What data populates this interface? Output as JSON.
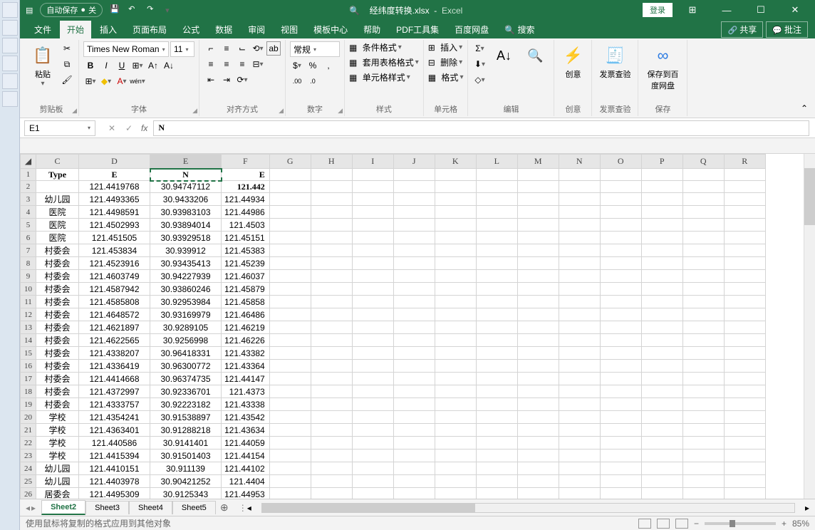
{
  "titlebar": {
    "autosave": "自动保存",
    "autosave_state": "关",
    "filename": "经纬度转换.xlsx",
    "app": "Excel",
    "login": "登录"
  },
  "tabs": {
    "file": "文件",
    "home": "开始",
    "insert": "插入",
    "pagelayout": "页面布局",
    "formulas": "公式",
    "data": "数据",
    "review": "审阅",
    "view": "视图",
    "template": "模板中心",
    "help": "帮助",
    "pdf": "PDF工具集",
    "baidu": "百度网盘",
    "search": "搜索",
    "share": "共享",
    "comment": "批注"
  },
  "ribbon": {
    "clipboard": {
      "paste": "粘贴",
      "label": "剪贴板"
    },
    "font": {
      "family": "Times New Roman",
      "size": "11",
      "label": "字体"
    },
    "align": {
      "label": "对齐方式"
    },
    "number": {
      "format": "常规",
      "label": "数字"
    },
    "styles": {
      "cond": "条件格式",
      "table": "套用表格格式",
      "cell": "单元格样式",
      "label": "样式"
    },
    "cells": {
      "insert": "插入",
      "delete": "删除",
      "format": "格式",
      "label": "单元格"
    },
    "editing": {
      "label": "编辑"
    },
    "creative": {
      "btn": "创意",
      "label": "创意"
    },
    "invoice": {
      "btn": "发票查验",
      "label": "发票查验"
    },
    "save": {
      "btn": "保存到百度网盘",
      "label": "保存"
    }
  },
  "namebox": {
    "ref": "E1",
    "formula": "N"
  },
  "columns": [
    "C",
    "D",
    "E",
    "F",
    "G",
    "H",
    "I",
    "J",
    "K",
    "L",
    "M",
    "N",
    "O",
    "P",
    "Q",
    "R"
  ],
  "headers": {
    "c": "Type",
    "d": "E",
    "e": "N",
    "f": "E"
  },
  "chart_data": {
    "type": "table",
    "columns": [
      "row",
      "Type",
      "E",
      "N",
      "F"
    ],
    "rows": [
      [
        2,
        "",
        "121.4419768",
        "30.94747112",
        "121.442"
      ],
      [
        3,
        "幼儿园",
        "121.4493365",
        "30.9433206",
        "121.44934"
      ],
      [
        4,
        "医院",
        "121.4498591",
        "30.93983103",
        "121.44986"
      ],
      [
        5,
        "医院",
        "121.4502993",
        "30.93894014",
        "121.4503"
      ],
      [
        6,
        "医院",
        "121.451505",
        "30.93929518",
        "121.45151"
      ],
      [
        7,
        "村委会",
        "121.453834",
        "30.939912",
        "121.45383"
      ],
      [
        8,
        "村委会",
        "121.4523916",
        "30.93435413",
        "121.45239"
      ],
      [
        9,
        "村委会",
        "121.4603749",
        "30.94227939",
        "121.46037"
      ],
      [
        10,
        "村委会",
        "121.4587942",
        "30.93860246",
        "121.45879"
      ],
      [
        11,
        "村委会",
        "121.4585808",
        "30.92953984",
        "121.45858"
      ],
      [
        12,
        "村委会",
        "121.4648572",
        "30.93169979",
        "121.46486"
      ],
      [
        13,
        "村委会",
        "121.4621897",
        "30.9289105",
        "121.46219"
      ],
      [
        14,
        "村委会",
        "121.4622565",
        "30.9256998",
        "121.46226"
      ],
      [
        15,
        "村委会",
        "121.4338207",
        "30.96418331",
        "121.43382"
      ],
      [
        16,
        "村委会",
        "121.4336419",
        "30.96300772",
        "121.43364"
      ],
      [
        17,
        "村委会",
        "121.4414668",
        "30.96374735",
        "121.44147"
      ],
      [
        18,
        "村委会",
        "121.4372997",
        "30.92336701",
        "121.4373"
      ],
      [
        19,
        "村委会",
        "121.4333757",
        "30.92223182",
        "121.43338"
      ],
      [
        20,
        "学校",
        "121.4354241",
        "30.91538897",
        "121.43542"
      ],
      [
        21,
        "学校",
        "121.4363401",
        "30.91288218",
        "121.43634"
      ],
      [
        22,
        "学校",
        "121.440586",
        "30.9141401",
        "121.44059"
      ],
      [
        23,
        "学校",
        "121.4415394",
        "30.91501403",
        "121.44154"
      ],
      [
        24,
        "幼儿园",
        "121.4410151",
        "30.911139",
        "121.44102"
      ],
      [
        25,
        "幼儿园",
        "121.4403978",
        "30.90421252",
        "121.4404"
      ],
      [
        26,
        "居委会",
        "121.4495309",
        "30.9125343",
        "121.44953"
      ]
    ]
  },
  "sheets": {
    "s2": "Sheet2",
    "s3": "Sheet3",
    "s4": "Sheet4",
    "s5": "Sheet5"
  },
  "status": {
    "msg": "使用鼠标将复制的格式应用到其他对象",
    "zoom": "85%"
  }
}
